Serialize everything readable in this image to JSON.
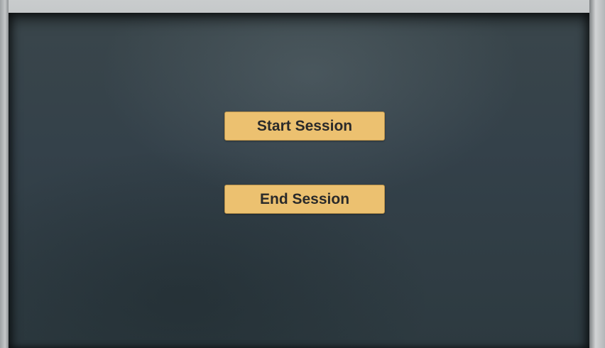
{
  "buttons": {
    "start_label": "Start Session",
    "end_label": "End Session"
  },
  "colors": {
    "board": "#34414a",
    "button": "#ecc170",
    "frame": "#b9bcbe"
  }
}
